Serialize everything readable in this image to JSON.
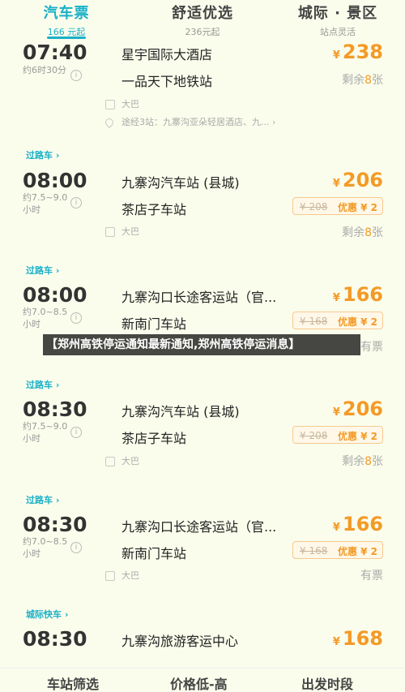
{
  "tabs": [
    {
      "title": "汽车票",
      "sub": "166 元起"
    },
    {
      "title": "舒适优选",
      "sub": "236元起"
    },
    {
      "title": "城际 · 景区",
      "sub": "站点灵活"
    }
  ],
  "trips": [
    {
      "tag": "",
      "time": "07:40",
      "duration": "约6时30分",
      "from": "星宇国际大酒店",
      "to": "一品天下地铁站",
      "price": "238",
      "orig": "",
      "discount": "",
      "remain_pre": "剩余",
      "remain_num": "8",
      "remain_post": "张",
      "vehicle": "大巴",
      "route": "途经3站：九寨沟亚朵轻居酒店、九..."
    },
    {
      "tag": "过路车 ›",
      "time": "08:00",
      "duration": "约7.5~9.0小时",
      "from": "九寨沟汽车站 (县城)",
      "to": "茶店子车站",
      "price": "206",
      "orig": "¥ 208",
      "discount": "优惠 ¥ 2",
      "remain_pre": "剩余",
      "remain_num": "8",
      "remain_post": "张",
      "vehicle": "大巴",
      "route": ""
    },
    {
      "tag": "过路车 ›",
      "time": "08:00",
      "duration": "约7.0~8.5小时",
      "from": "九寨沟口长途客运站（官...",
      "to": "新南门车站",
      "price": "166",
      "orig": "¥ 168",
      "discount": "优惠 ¥ 2",
      "remain_pre": "",
      "remain_num": "",
      "remain_post": "有票",
      "vehicle": "",
      "route": ""
    },
    {
      "tag": "过路车 ›",
      "time": "08:30",
      "duration": "约7.5~9.0小时",
      "from": "九寨沟汽车站 (县城)",
      "to": "茶店子车站",
      "price": "206",
      "orig": "¥ 208",
      "discount": "优惠 ¥ 2",
      "remain_pre": "剩余",
      "remain_num": "8",
      "remain_post": "张",
      "vehicle": "大巴",
      "route": ""
    },
    {
      "tag": "过路车 ›",
      "time": "08:30",
      "duration": "约7.0~8.5小时",
      "from": "九寨沟口长途客运站（官...",
      "to": "新南门车站",
      "price": "166",
      "orig": "¥ 168",
      "discount": "优惠 ¥ 2",
      "remain_pre": "",
      "remain_num": "",
      "remain_post": "有票",
      "vehicle": "大巴",
      "route": ""
    },
    {
      "tag": "城际快车 ›",
      "time": "08:30",
      "duration": "",
      "from": "九寨沟旅游客运中心",
      "to": "",
      "price": "168",
      "orig": "",
      "discount": "",
      "remain_pre": "",
      "remain_num": "",
      "remain_post": "",
      "vehicle": "",
      "route": ""
    }
  ],
  "currency": "¥",
  "banner": "【郑州高铁停运通知最新通知,郑州高铁停运消息】",
  "bottom": [
    "车站筛选",
    "价格低-高",
    "出发时段"
  ]
}
